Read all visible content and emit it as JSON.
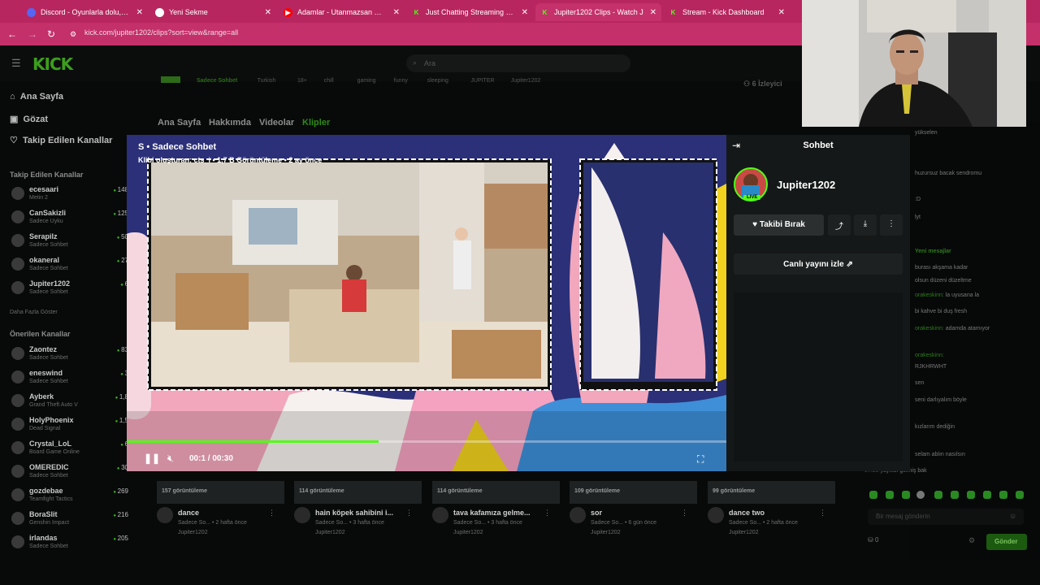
{
  "tabs": [
    {
      "icon": "discord-icon",
      "label": "Discord - Oyunlarla dolu, eğlen",
      "close": "✕",
      "color": "#5865f2"
    },
    {
      "icon": "chrome-icon",
      "label": "Yeni Sekme",
      "close": "✕",
      "color": "#ffffff"
    },
    {
      "icon": "youtube-icon",
      "label": "Adamlar - Utanmazsan Unutm",
      "close": "✕",
      "color": "#ff0000"
    },
    {
      "icon": "kick-icon",
      "label": "Just Chatting Streaming - Live",
      "close": "✕",
      "color": "#53fc18"
    },
    {
      "icon": "kick-icon",
      "label": "Jupiter1202 Clips - Watch J",
      "close": "✕",
      "color": "#53fc18"
    },
    {
      "icon": "kick-icon",
      "label": "Stream - Kick Dashboard",
      "close": "✕",
      "color": "#53fc18"
    }
  ],
  "browser": {
    "url": "kick.com/jupiter1202/clips?sort=view&range=all"
  },
  "site": {
    "logo": "KICK",
    "search_placeholder": "Ara"
  },
  "nav": {
    "home": "Ana Sayfa",
    "browse": "Gözat",
    "following": "Takip Edilen Kanallar"
  },
  "followed": {
    "heading": "Takip Edilen Kanallar",
    "items": [
      {
        "name": "ecesaari",
        "cat": "Metin 2",
        "viewers": "148"
      },
      {
        "name": "CanSakizli",
        "cat": "Sadece Uyku",
        "viewers": "125"
      },
      {
        "name": "Serapilz",
        "cat": "Sadece Sohbet",
        "viewers": "50"
      },
      {
        "name": "okaneral",
        "cat": "Sadece Sohbet",
        "viewers": "27"
      },
      {
        "name": "Jupiter1202",
        "cat": "Sadece Sohbet",
        "viewers": "6"
      }
    ],
    "more": "Daha Fazla Göster"
  },
  "recommended": {
    "heading": "Önerilen Kanallar",
    "items": [
      {
        "name": "Zaontez",
        "cat": "Sadece Sohbet",
        "viewers": "83"
      },
      {
        "name": "eneswind",
        "cat": "Sadece Sohbet",
        "viewers": "3"
      },
      {
        "name": "Ayberk",
        "cat": "Grand Theft Auto V",
        "viewers": "1,8"
      },
      {
        "name": "HolyPhoenix",
        "cat": "Dead Signal",
        "viewers": "1,5"
      },
      {
        "name": "Crystal_LoL",
        "cat": "Board Game Online",
        "viewers": "6"
      },
      {
        "name": "OMEREDIC",
        "cat": "Sadece Sohbet",
        "viewers": "30"
      },
      {
        "name": "gozdebae",
        "cat": "Teamfight Tactics",
        "viewers": "269"
      },
      {
        "name": "BoraSlit",
        "cat": "Genshin Impact",
        "viewers": "216"
      },
      {
        "name": "irlandas",
        "cat": "Sadece Sohbet",
        "viewers": "205"
      }
    ]
  },
  "channel": {
    "tags": [
      "Sadece Sohbet",
      "Turkish",
      "18+",
      "chill",
      "gaming",
      "funny",
      "sleeping",
      "JUPITER",
      "Jupiter1202"
    ],
    "viewers": "6 İzleyici",
    "tabs": [
      "Ana Sayfa",
      "Hakkımda",
      "Videolar",
      "Klipler"
    ]
  },
  "clip": {
    "title": "S • Sadece Sohbet",
    "meta": "Klibi oluşturan: cts_i • 1,7 B Görüntüleme • 2 ay önce",
    "time": "00:1 / 00:30",
    "progress": 0.42
  },
  "panel": {
    "header": "Sohbet",
    "streamer": "Jupiter1202",
    "live_badge": "LIVE",
    "unfollow": "Takibi Bırak",
    "watch_live": "Canlı yayını izle",
    "watch_icon": "external-link-icon"
  },
  "chat": {
    "lines": [
      {
        "user": "",
        "msg": "yükselen"
      },
      {
        "user": "",
        "msg": "huzursuz bacak sendromu"
      },
      {
        "user": "",
        "msg": ":D"
      },
      {
        "user": "",
        "msg": "lyt"
      },
      {
        "user": "",
        "msg": "Yeni mesajlar"
      },
      {
        "user": "",
        "msg": "burası akşama kadar"
      },
      {
        "user": "",
        "msg": "olsun düzeni düzeltme"
      },
      {
        "user": "orakeskinn:",
        "msg": "la uyusana la"
      },
      {
        "user": "",
        "msg": "bi kahve bi duş fresh"
      },
      {
        "user": "orakeskinn:",
        "msg": "adamda atamıyor"
      },
      {
        "user": "orakeskinn:",
        "msg": ""
      },
      {
        "user": "",
        "msg": "RJKHRWHT"
      },
      {
        "user": "",
        "msg": "sen"
      },
      {
        "user": "",
        "msg": "seni darlıyalım böyle"
      },
      {
        "user": "",
        "msg": "kızlarım dediğin"
      },
      {
        "user": "",
        "msg": "selam ablın nasılsın"
      },
      {
        "user": "07:20",
        "msg": "yayıkcı gelmiş bak"
      }
    ],
    "placeholder": "Bir mesaj gönderin",
    "points": "0",
    "send": "Gönder"
  },
  "clips": [
    {
      "views": "157 görüntüleme",
      "title": "dance",
      "meta": "Sadece So... • 2 hafta önce",
      "author": "Jupiter1202"
    },
    {
      "views": "114 görüntüleme",
      "title": "hain köpek sahibini i...",
      "meta": "Sadece So... • 3 hafta önce",
      "author": "Jupiter1202"
    },
    {
      "views": "114 görüntüleme",
      "title": "tava kafamıza gelme...",
      "meta": "Sadece So... • 3 hafta önce",
      "author": "Jupiter1202"
    },
    {
      "views": "109 görüntüleme",
      "title": "sor",
      "meta": "Sadece So... • 6 gün önce",
      "author": "Jupiter1202"
    },
    {
      "views": "99 görüntüleme",
      "title": "dance two",
      "meta": "Sadece So... • 2 hafta önce",
      "author": "Jupiter1202"
    }
  ],
  "colors": {
    "tabbar": "#b8265f",
    "kick_green": "#53fc18",
    "panel": "#151818"
  }
}
